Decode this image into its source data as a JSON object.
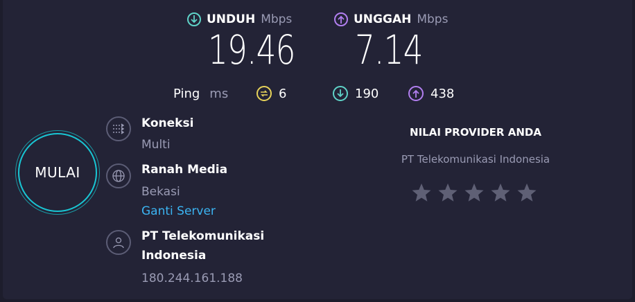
{
  "download": {
    "label": "UNDUH",
    "unit": "Mbps",
    "value": "19.46"
  },
  "upload": {
    "label": "UNGGAH",
    "unit": "Mbps",
    "value": "7.14"
  },
  "ping": {
    "label": "Ping",
    "unit": "ms",
    "idle": "6",
    "download": "190",
    "upload": "438"
  },
  "start_button": {
    "label": "MULAI"
  },
  "connection": {
    "title": "Koneksi",
    "value": "Multi"
  },
  "server": {
    "title": "Ranah Media",
    "location": "Bekasi",
    "change_link": "Ganti Server"
  },
  "provider": {
    "line1": "PT Telekomunikasi",
    "line2": "Indonesia",
    "ip": "180.244.161.188"
  },
  "rating": {
    "title": "NILAI PROVIDER ANDA",
    "provider": "PT Telekomunikasi Indonesia",
    "stars": 5,
    "filled": 0
  },
  "colors": {
    "download": "#5fd3c8",
    "upload": "#b27ff0",
    "ping_idle": "#e7d35a",
    "link": "#3bb4f2",
    "ring": "#19c5d3"
  }
}
